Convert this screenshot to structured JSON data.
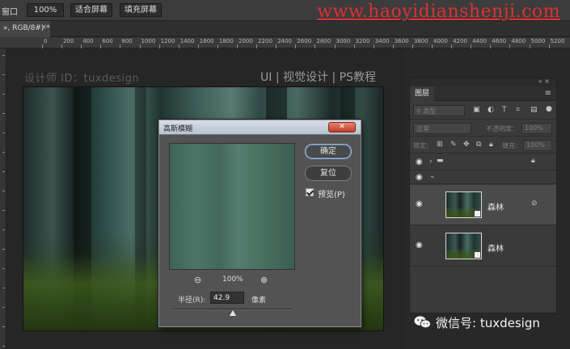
{
  "options_bar": {
    "window_label": "窗口",
    "zoom_value": "100%",
    "fit_screen": "适合屏幕",
    "fill_screen": "填充屏幕"
  },
  "watermark_url": "www.haoyidianshenji.com",
  "document_tab": {
    "label": "», RGB/8#) *",
    "close": "×"
  },
  "ruler_marks": [
    "0",
    "200",
    "400",
    "600",
    "800",
    "1000",
    "1200",
    "1400",
    "1600",
    "1800",
    "2000",
    "2200",
    "2400",
    "2600",
    "2800",
    "3000",
    "3200",
    "3400",
    "3600",
    "3800",
    "4000",
    "4200",
    "4400",
    "4600",
    "4800",
    "5000",
    "5200"
  ],
  "canvas_overlay": {
    "designer": "设计师 ID：tuxdesign",
    "tagline": "UI | 视觉设计 | PS教程"
  },
  "dialog": {
    "title": "高斯模糊",
    "close": "✕",
    "ok_label": "确定",
    "reset_label": "复位",
    "preview_label": "预览(P)",
    "preview_checked": true,
    "zoom_percent": "100%",
    "radius_label": "半径(R):",
    "radius_value": "42.9",
    "radius_unit": "像素",
    "radius_slider_fraction": 0.5
  },
  "layers_panel": {
    "collapse": "« ×",
    "tab_label": "图层",
    "menu_icon": "hamburger-icon",
    "filter_kind": "类型",
    "blend_mode": "正常",
    "opacity_label": "不透明度：",
    "opacity_value": "100%",
    "lock_label": "锁定：",
    "fill_label": "填充：",
    "fill_value": "100%",
    "layers": [
      {
        "name": "",
        "kind": "group",
        "visible": true,
        "locked": true
      },
      {
        "name": "",
        "kind": "group-expanded",
        "visible": true
      },
      {
        "name": "森林",
        "kind": "smart-object",
        "visible": true,
        "selected": true
      },
      {
        "name": "森林",
        "kind": "smart-object",
        "visible": true,
        "selected": false
      }
    ]
  },
  "wechat_watermark": "微信号: tuxdesign",
  "colors": {
    "dialog_titlebar": "#c6cfdc",
    "close_button": "#c94b34",
    "watermark_red": "#e03030"
  }
}
